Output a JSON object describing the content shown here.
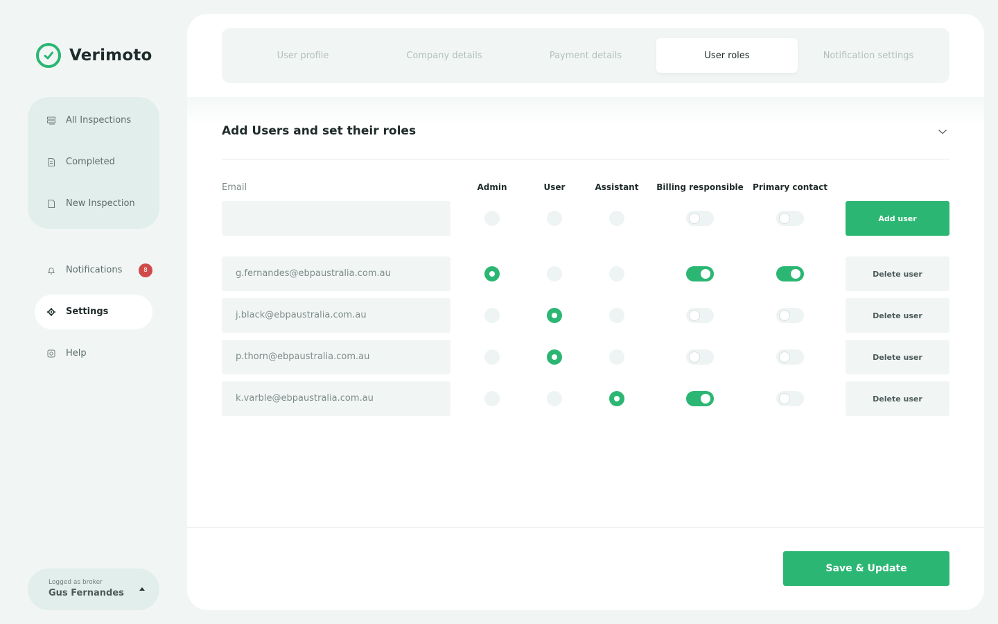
{
  "app": {
    "name": "Verimoto",
    "accent": "#2bb673",
    "badge_color": "#d04a4a"
  },
  "sidebar": {
    "group_items": [
      {
        "label": "All Inspections",
        "icon": "inspections-icon"
      },
      {
        "label": "Completed",
        "icon": "document-icon"
      },
      {
        "label": "New Inspection",
        "icon": "new-document-icon"
      }
    ],
    "notifications": {
      "label": "Notifications",
      "count": "8"
    },
    "settings": {
      "label": "Settings"
    },
    "help": {
      "label": "Help"
    }
  },
  "user": {
    "role_label": "Logged as broker",
    "name": "Gus Fernandes"
  },
  "tabs": [
    "User profile",
    "Company details",
    "Payment details",
    "User roles",
    "Notification settings"
  ],
  "active_tab": "User roles",
  "section": {
    "title": "Add Users and set their roles"
  },
  "columns": {
    "email": "Email",
    "admin": "Admin",
    "user": "User",
    "assistant": "Assistant",
    "billing": "Billing responsible",
    "primary": "Primary contact"
  },
  "new_user": {
    "email_value": "",
    "add_label": "Add user"
  },
  "users": [
    {
      "email": "g.fernandes@ebpaustralia.com.au",
      "role": "Admin",
      "billing": true,
      "primary": true,
      "delete_label": "Delete user"
    },
    {
      "email": "j.black@ebpaustralia.com.au",
      "role": "User",
      "billing": false,
      "primary": false,
      "delete_label": "Delete user"
    },
    {
      "email": "p.thorn@ebpaustralia.com.au",
      "role": "User",
      "billing": false,
      "primary": false,
      "delete_label": "Delete user"
    },
    {
      "email": "k.varble@ebpaustralia.com.au",
      "role": "Assistant",
      "billing": true,
      "primary": false,
      "delete_label": "Delete user"
    }
  ],
  "footer": {
    "save_label": "Save & Update"
  }
}
